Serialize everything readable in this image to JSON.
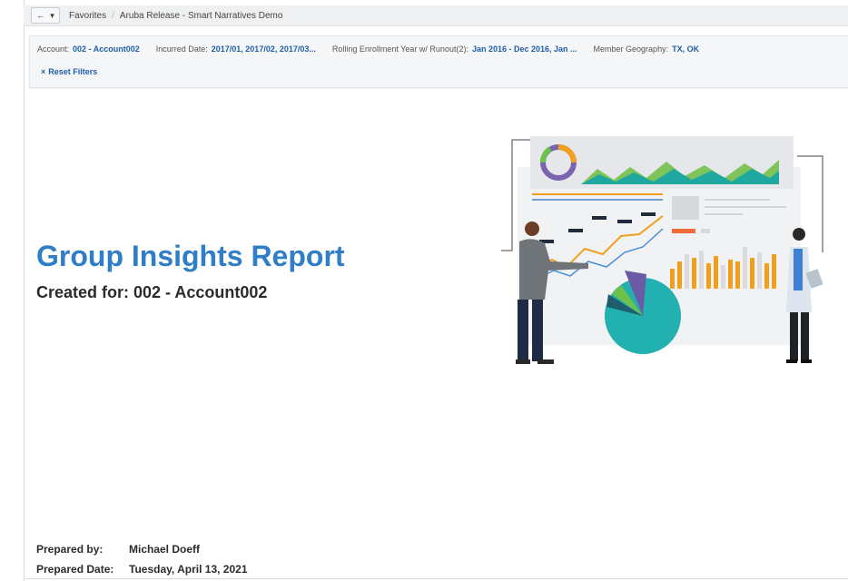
{
  "nav": {
    "back_glyph": "←",
    "menu_glyph": "▾",
    "breadcrumbs": [
      "Favorites",
      "Aruba Release - Smart Narratives Demo"
    ]
  },
  "filters": [
    {
      "label": "Account:",
      "value": "002 - Account002"
    },
    {
      "label": "Incurred Date:",
      "value": "2017/01, 2017/02, 2017/03..."
    },
    {
      "label": "Rolling Enrollment Year w/ Runout(2):",
      "value": "Jan 2016 - Dec 2016, Jan ..."
    },
    {
      "label": "Member Geography:",
      "value": "TX, OK"
    }
  ],
  "reset": {
    "icon": "×",
    "label": "Reset Filters"
  },
  "report": {
    "title": "Group Insights Report",
    "subtitle": "Created for: 002 - Account002"
  },
  "footer": {
    "prepared_by_label": "Prepared by:",
    "prepared_by_value": "Michael Doeff",
    "prepared_date_label": "Prepared Date:",
    "prepared_date_value": "Tuesday, April 13, 2021"
  },
  "colors": {
    "title_blue": "#2f7ec7",
    "link_blue": "#1f5fa8",
    "teal": "#22a7a7",
    "green": "#6cc24a",
    "orange": "#f0a01e",
    "purple": "#6b5aa6"
  }
}
